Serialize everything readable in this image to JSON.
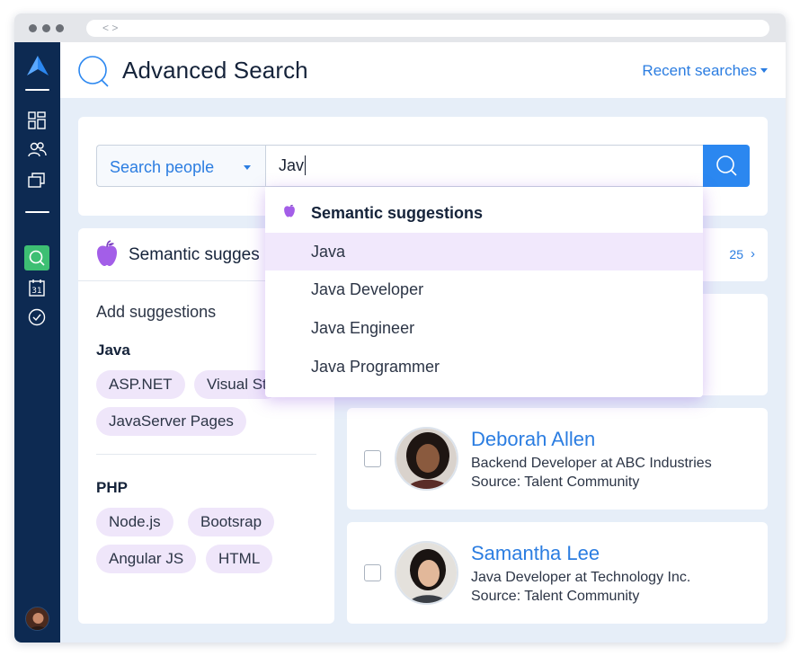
{
  "browser": {
    "url_text": "< >"
  },
  "header": {
    "title": "Advanced Search",
    "recent_searches": "Recent searches"
  },
  "search": {
    "type_selected": "Search people",
    "query": "Jav"
  },
  "dropdown": {
    "title": "Semantic suggestions",
    "items": [
      {
        "label": "Java",
        "active": true
      },
      {
        "label": "Java Developer",
        "active": false
      },
      {
        "label": "Java Engineer",
        "active": false
      },
      {
        "label": "Java Programmer",
        "active": false
      }
    ]
  },
  "semantic_panel": {
    "title": "Semantic sugges",
    "add_label": "Add suggestions",
    "groups": [
      {
        "title": "Java",
        "chips": [
          "ASP.NET",
          "Visual St",
          "JavaServer Pages"
        ]
      },
      {
        "title": "PHP",
        "chips": [
          "Node.js",
          "Bootsrap",
          "Angular JS",
          "HTML"
        ]
      }
    ]
  },
  "results": {
    "count_text": "25",
    "people": [
      {
        "name": "Deborah Allen",
        "role": "Backend Developer at ABC Industries",
        "source": "Source: Talent Community"
      },
      {
        "name": "Samantha Lee",
        "role": "Java Developer at Technology Inc.",
        "source": "Source: Talent Community"
      }
    ]
  },
  "colors": {
    "accent": "#2b7de1",
    "sidebar": "#0d2a52",
    "active_nav": "#3dbf73",
    "chip": "#efe6fa",
    "semantic": "#a35ee8"
  }
}
